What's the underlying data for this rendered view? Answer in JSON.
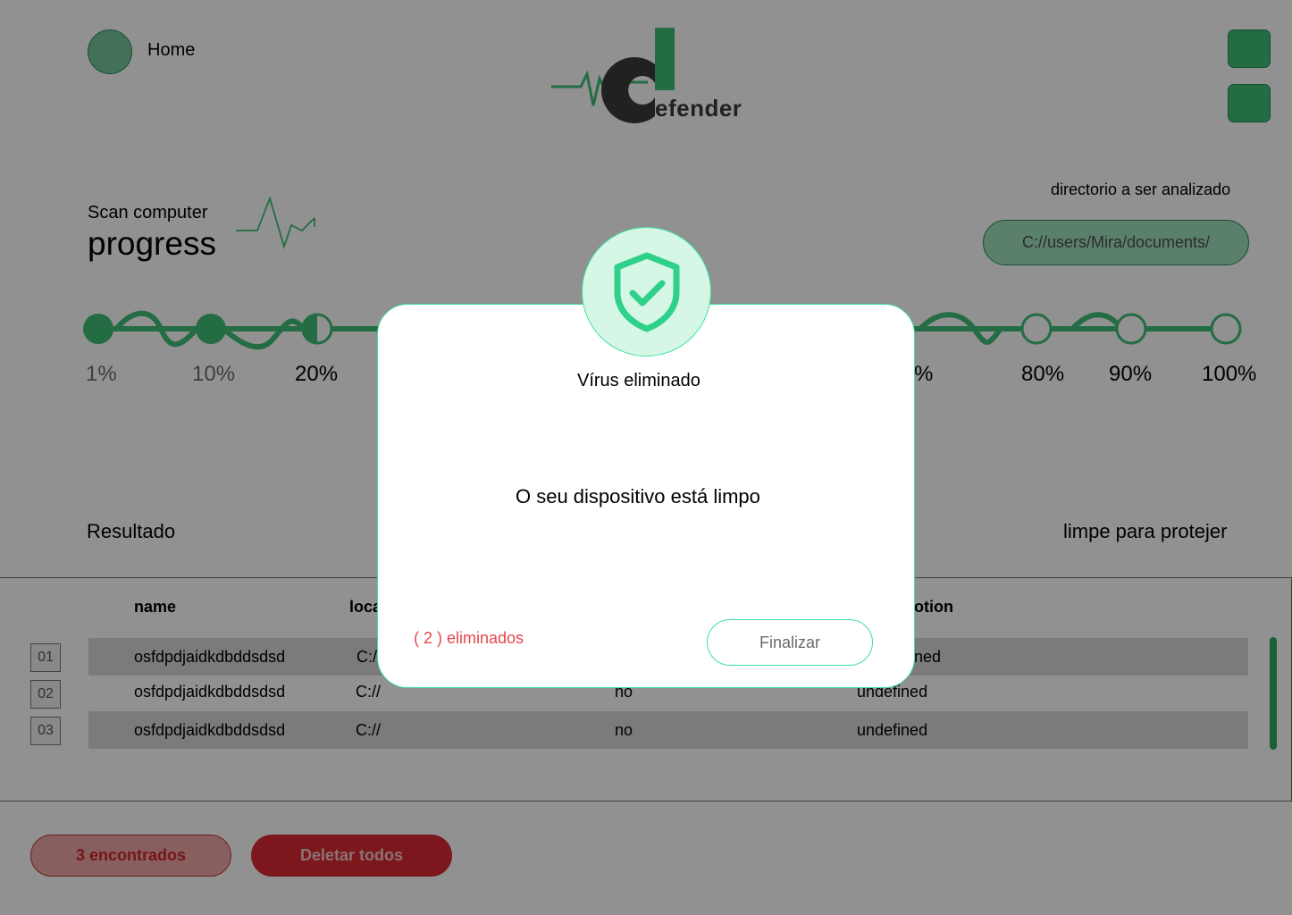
{
  "header": {
    "home_label": "Home",
    "logo_text": "efender"
  },
  "scan": {
    "subtitle": "Scan computer",
    "title": "progress",
    "directory_label": "directorio a ser analizado",
    "directory_value": "C://users/Mira/documents/",
    "steps": [
      {
        "label": "1%",
        "state": "done"
      },
      {
        "label": "10%",
        "state": "done"
      },
      {
        "label": "20%",
        "state": "half"
      },
      {
        "label": "%",
        "state": "done"
      },
      {
        "label": "80%",
        "state": "pending"
      },
      {
        "label": "90%",
        "state": "pending"
      },
      {
        "label": "100%",
        "state": "pending"
      }
    ]
  },
  "results": {
    "title": "Resultado",
    "hint": "limpe para protejer",
    "columns": {
      "name": "name",
      "location": "loca",
      "action": "otion"
    },
    "rows": [
      {
        "index": "01",
        "name": "osfdpdjaidkdbddsdsd",
        "location": "C:/",
        "infected": "",
        "action": "ned"
      },
      {
        "index": "02",
        "name": "osfdpdjaidkdbddsdsd",
        "location": "C://",
        "infected": "no",
        "action": "undefined"
      },
      {
        "index": "03",
        "name": "osfdpdjaidkdbddsdsd",
        "location": "C://",
        "infected": "no",
        "action": "undefined"
      }
    ]
  },
  "footer": {
    "found_label": "3 encontrados",
    "delete_label": "Deletar todos"
  },
  "modal": {
    "title": "Vírus eliminado",
    "message": "O seu dispositivo está limpo",
    "count_text": "( 2 ) eliminados",
    "finish_label": "Finalizar"
  },
  "colors": {
    "accent_green": "#3fbf78",
    "modal_border": "#3ee0a0",
    "danger_red": "#d92a34",
    "count_red": "#e5474c"
  },
  "icons": {
    "shield": "shield-check-icon",
    "pulse": "pulse-icon"
  }
}
